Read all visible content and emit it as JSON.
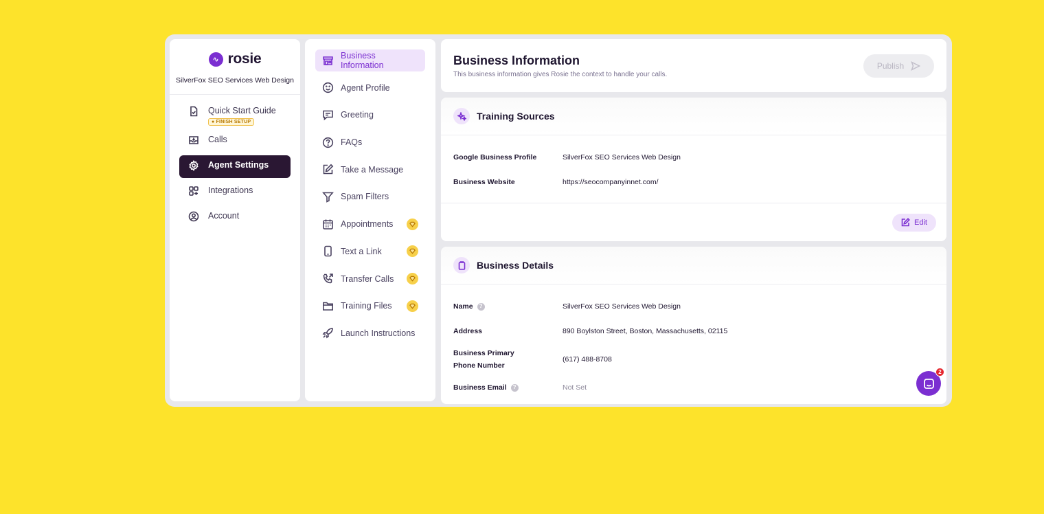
{
  "brand": {
    "name": "rosie",
    "company": "SilverFox SEO Services Web Design"
  },
  "nav": {
    "items": [
      {
        "label": "Quick Start Guide",
        "badge": "● FINISH SETUP",
        "icon": "file-check-icon"
      },
      {
        "label": "Calls",
        "icon": "inbox-icon"
      },
      {
        "label": "Agent Settings",
        "icon": "gear-icon",
        "active": true
      },
      {
        "label": "Integrations",
        "icon": "apps-icon"
      },
      {
        "label": "Account",
        "icon": "user-circle-icon"
      }
    ]
  },
  "menu": {
    "items": [
      {
        "label": "Business Information",
        "icon": "store-icon",
        "active": true
      },
      {
        "label": "Agent Profile",
        "icon": "smile-icon"
      },
      {
        "label": "Greeting",
        "icon": "message-icon"
      },
      {
        "label": "FAQs",
        "icon": "question-icon"
      },
      {
        "label": "Take a Message",
        "icon": "pencil-square-icon"
      },
      {
        "label": "Spam Filters",
        "icon": "filter-icon"
      },
      {
        "label": "Appointments",
        "icon": "calendar-icon",
        "premium": true
      },
      {
        "label": "Text a Link",
        "icon": "phone-icon",
        "premium": true
      },
      {
        "label": "Transfer Calls",
        "icon": "phone-forward-icon",
        "premium": true
      },
      {
        "label": "Training Files",
        "icon": "folder-icon",
        "premium": true
      },
      {
        "label": "Launch Instructions",
        "icon": "rocket-icon"
      }
    ]
  },
  "header": {
    "title": "Business Information",
    "subtitle": "This business information gives Rosie the context to handle your calls.",
    "publish_label": "Publish"
  },
  "training": {
    "title": "Training Sources",
    "rows": [
      {
        "key": "Google Business Profile",
        "value": "SilverFox SEO Services Web Design"
      },
      {
        "key": "Business Website",
        "value": "https://seocompanyinnet.com/"
      }
    ],
    "edit_label": "Edit"
  },
  "details": {
    "title": "Business Details",
    "rows": [
      {
        "key": "Name",
        "value": "SilverFox SEO Services Web Design",
        "info": true
      },
      {
        "key": "Address",
        "value": "890 Boylston Street, Boston, Massachusetts, 02115"
      },
      {
        "key": "Business Primary Phone Number",
        "value": "(617) 488-8708"
      },
      {
        "key": "Business Email",
        "value": "Not Set",
        "info": true
      }
    ]
  },
  "chat": {
    "badge": "2"
  },
  "colors": {
    "background": "#fde32b",
    "accent": "#7b2fd1",
    "nav_active": "#2a1733",
    "premium": "#f7d04a"
  }
}
